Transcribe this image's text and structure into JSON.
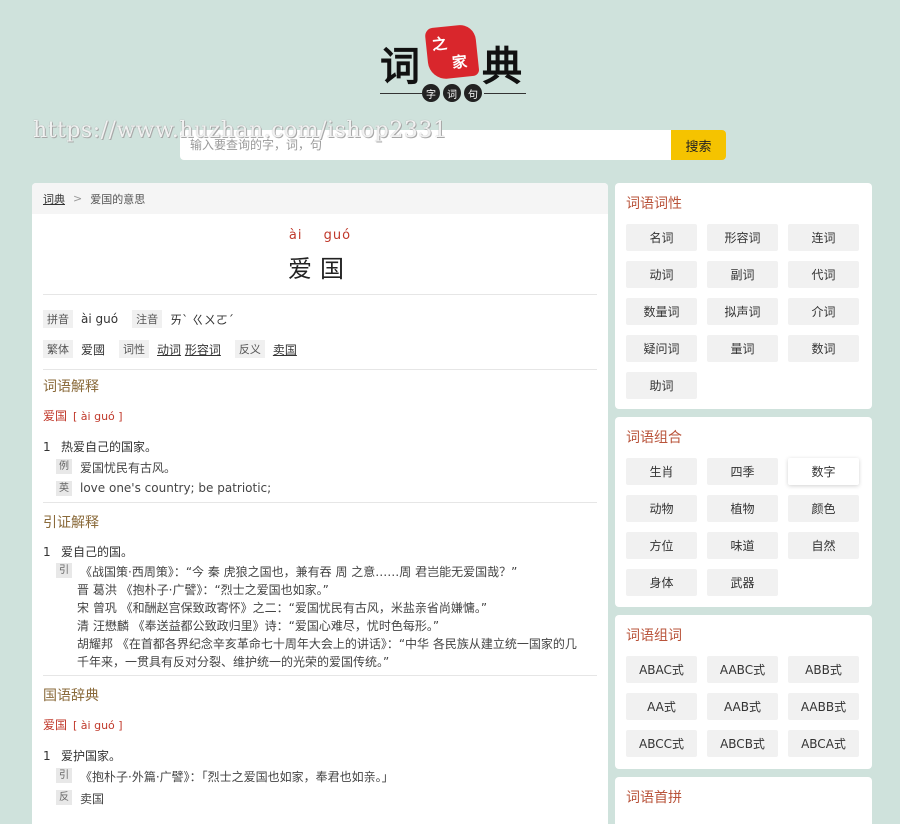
{
  "logo": {
    "chars": [
      "词",
      "之",
      "家",
      "典"
    ],
    "sub": [
      "字",
      "词",
      "句"
    ]
  },
  "watermark": "https://www.huzhan.com/ishop2331",
  "search": {
    "placeholder": "输入要查询的字，词，句",
    "button": "搜索"
  },
  "breadcrumb": {
    "home": "词典",
    "current": "爱国的意思"
  },
  "word": {
    "pinyin": [
      "ài",
      "guó"
    ],
    "chars": "爱国",
    "pinyin_label": "拼音",
    "pinyin_value": "ài guó",
    "zhuyin_label": "注音",
    "zhuyin_value": "ㄞˋ ㄍㄨㄛˊ",
    "fanti_label": "繁体",
    "fanti_value": "爱國",
    "cixing_label": "词性",
    "cixing_values": [
      "动词",
      "形容词"
    ],
    "fanyi_label": "反义",
    "fanyi_value": "卖国"
  },
  "section1": {
    "title": "词语解释",
    "term": "爱国",
    "term_pinyin": "[ ài guó ]",
    "num": "1",
    "def": "热爱自己的国家。",
    "example_tag": "例",
    "example": "爱国忧民有古风。",
    "english_tag": "英",
    "english": "love one's country; be patriotic;"
  },
  "section2": {
    "title": "引证解释",
    "num": "1",
    "def": "爱自己的国。",
    "tag": "引",
    "quotes": [
      "《战国策·西周策》：“今 秦 虎狼之国也，兼有吞 周 之意……周 君岂能无爱国哉？”",
      "晋 葛洪 《抱朴子·广譬》：“烈士之爱国也如家。”",
      "宋 曾巩 《和酬赵宫保致政寄怀》之二：“爱国忧民有古风，米盐亲省尚嫌慵。”",
      "清 汪懋麟 《奉送益都公致政归里》诗：“爱国心难尽，忧时色每形。”",
      "胡耀邦 《在首都各界纪念辛亥革命七十周年大会上的讲话》：“中华 各民族从建立统一国家的几",
      "千年来，一贯具有反对分裂、维护统一的光荣的爱国传统。”"
    ]
  },
  "section3": {
    "title": "国语辞典",
    "term": "爱国",
    "term_pinyin": "[ ài guó ]",
    "num": "1",
    "def": "爱护国家。",
    "tag1": "引",
    "quote": "《抱朴子·外篇·广譬》：「烈士之爱国也如家，奉君也如亲。」",
    "tag2": "反",
    "antonym": "卖国"
  },
  "sidebar": {
    "cixing": {
      "title": "词语词性",
      "items": [
        "名词",
        "形容词",
        "连词",
        "动词",
        "副词",
        "代词",
        "数量词",
        "拟声词",
        "介词",
        "疑问词",
        "量词",
        "数词",
        "助词"
      ]
    },
    "zuhe": {
      "title": "词语组合",
      "items": [
        "生肖",
        "四季",
        "数字",
        "动物",
        "植物",
        "颜色",
        "方位",
        "味道",
        "自然",
        "身体",
        "武器"
      ],
      "active": "数字"
    },
    "zuci": {
      "title": "词语组词",
      "items": [
        "ABAC式",
        "AABC式",
        "ABB式",
        "AA式",
        "AAB式",
        "AABB式",
        "ABCC式",
        "ABCB式",
        "ABCA式"
      ]
    },
    "shoupin": {
      "title": "词语首拼"
    }
  }
}
